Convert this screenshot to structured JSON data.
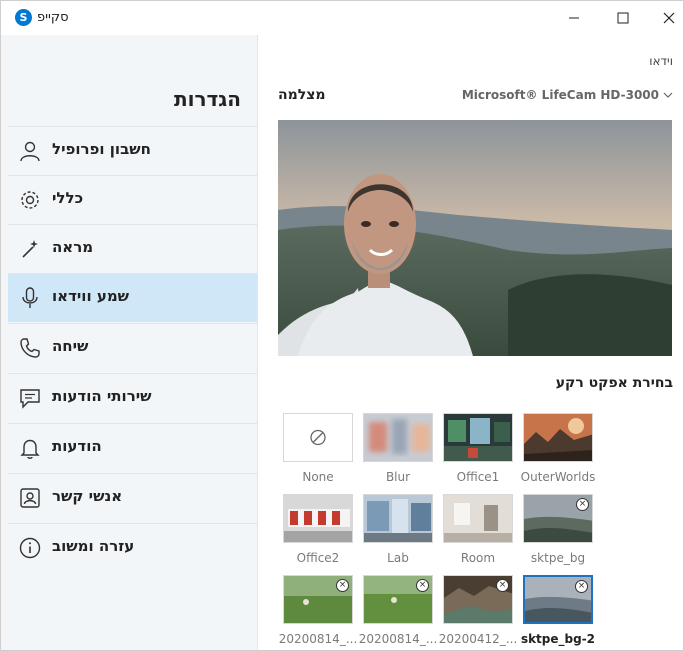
{
  "window": {
    "title": "סקייפ"
  },
  "sidebar": {
    "title": "הגדרות",
    "items": [
      {
        "label": "חשבון ופרופיל",
        "icon": "person-icon"
      },
      {
        "label": "כללי",
        "icon": "gear-icon"
      },
      {
        "label": "מראה",
        "icon": "magic-wand-icon"
      },
      {
        "label": "שמע ווידאו",
        "icon": "microphone-icon",
        "active": true
      },
      {
        "label": "שיחה",
        "icon": "phone-icon"
      },
      {
        "label": "שירותי הודעות",
        "icon": "chat-bubble-icon"
      },
      {
        "label": "הודעות",
        "icon": "bell-icon"
      },
      {
        "label": "אנשי קשר",
        "icon": "contact-card-icon"
      },
      {
        "label": "עזרה ומשוב",
        "icon": "info-icon"
      }
    ]
  },
  "main": {
    "section_label": "וידאו",
    "camera_label": "מצלמה",
    "device": "Microsoft® LifeCam HD-3000",
    "effect_title": "בחירת אפקט רקע",
    "backgrounds": [
      {
        "label": "None"
      },
      {
        "label": "Blur"
      },
      {
        "label": "Office1"
      },
      {
        "label": "OuterWorlds"
      },
      {
        "label": "Office2"
      },
      {
        "label": "Lab"
      },
      {
        "label": "Room"
      },
      {
        "label": "sktpe_bg",
        "removable": true
      },
      {
        "label": "20200814_...",
        "removable": true
      },
      {
        "label": "20200814_...",
        "removable": true
      },
      {
        "label": "20200412_...",
        "removable": true
      },
      {
        "label": "sktpe_bg-2",
        "removable": true,
        "selected": true
      }
    ]
  },
  "colors": {
    "accent": "#1e73be",
    "active_nav": "#cfe7f7",
    "sidebar_bg": "#f3f6f8",
    "logo": "#0078d4"
  }
}
